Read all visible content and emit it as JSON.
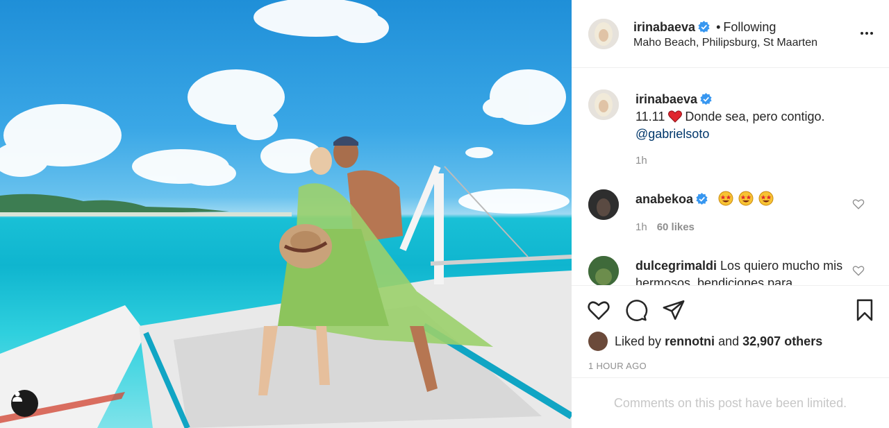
{
  "post": {
    "username": "irinabaeva",
    "follow_status": "Following",
    "separator": "•",
    "location": "Maho Beach, Philipsburg, St Maarten"
  },
  "caption": {
    "username": "irinabaeva",
    "date_text": "11.11",
    "text": "Donde sea, pero contigo.",
    "mention": "@gabrielsoto",
    "time": "1h"
  },
  "comments": [
    {
      "username": "anabekoa",
      "emoji_count": 3,
      "time": "1h",
      "likes": "60 likes"
    },
    {
      "username": "dulcegrimaldi",
      "text": "Los quiero mucho mis hermosos, bendiciones para"
    }
  ],
  "likes": {
    "prefix": "Liked by",
    "user": "rennotni",
    "joiner": "and",
    "others": "32,907 others"
  },
  "timestamp": "1 HOUR AGO",
  "comments_limited": "Comments on this post have been limited.",
  "colors": {
    "verified": "#3897f0",
    "mention": "#00376b",
    "muted": "#8e8e8e",
    "heart": "#ed4956"
  },
  "icons": [
    "user-tag-icon",
    "verified-icon",
    "more-icon",
    "heart-icon",
    "comment-icon",
    "share-icon",
    "bookmark-icon"
  ]
}
